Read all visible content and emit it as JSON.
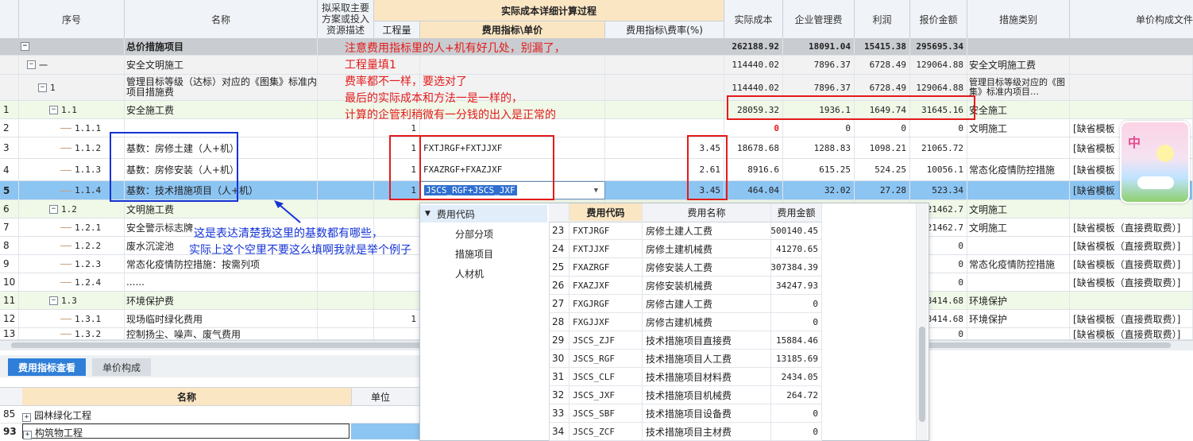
{
  "header": {
    "col_seq": "序号",
    "col_name": "名称",
    "col_resource": "拟采取主要方案或投入资源描述",
    "group_title": "实际成本详细计算过程",
    "col_qty": "工程量",
    "col_fee_index": "费用指标\\单价",
    "col_fee_rate": "费用指标\\费率(%)",
    "col_actual": "实际成本",
    "col_mgmt": "企业管理费",
    "col_profit": "利润",
    "col_quote": "报价金额",
    "col_category": "措施类别",
    "col_unit_comp": "单价构成文件"
  },
  "summary": {
    "name": "总价措施项目",
    "actual": "262188.92",
    "mgmt": "18091.04",
    "profit": "15415.38",
    "quote": "295695.34"
  },
  "rows": [
    {
      "seq": "",
      "code": "一",
      "name": "安全文明施工",
      "actual": "114440.02",
      "mgmt": "7896.37",
      "profit": "6728.49",
      "quote": "129064.88",
      "category": "安全文明施工费"
    },
    {
      "seq": "",
      "code": "1",
      "name": "管理目标等级（达标）对应的《图集》标准内项目措施费",
      "actual": "114440.02",
      "mgmt": "7896.37",
      "profit": "6728.49",
      "quote": "129064.88",
      "category": "管理目标等级对应的《图集》标准内项目…"
    },
    {
      "seq": "1",
      "code": "1.1",
      "name": "安全施工费",
      "actual": "28059.32",
      "mgmt": "1936.1",
      "profit": "1649.74",
      "quote": "31645.16",
      "category": "安全施工"
    },
    {
      "seq": "2",
      "code": "1.1.1",
      "name": "",
      "qty": "1",
      "actual": "0",
      "mgmt": "0",
      "profit": "0",
      "quote": "0",
      "category": "文明施工",
      "unit": "[缺省模板（"
    },
    {
      "seq": "3",
      "code": "1.1.2",
      "name": "基数：房修土建（人+机）",
      "qty": "1",
      "fee": "FXTJRGF+FXTJJXF",
      "rate": "3.45",
      "actual": "18678.68",
      "mgmt": "1288.83",
      "profit": "1098.21",
      "quote": "21065.72",
      "category": "",
      "unit": "[缺省模板（"
    },
    {
      "seq": "4",
      "code": "1.1.3",
      "name": "基数：房修安装（人+机）",
      "qty": "1",
      "fee": "FXAZRGF+FXAZJXF",
      "rate": "2.61",
      "actual": "8916.6",
      "mgmt": "615.25",
      "profit": "524.25",
      "quote": "10056.1",
      "category": "常态化疫情防控措施",
      "unit": "[缺省模板（"
    },
    {
      "seq": "5",
      "code": "1.1.4",
      "name": "基数：技术措施项目（人+机）",
      "qty": "1",
      "fee": "JSCS_RGF+JSCS_JXF",
      "rate": "3.45",
      "actual": "464.04",
      "mgmt": "32.02",
      "profit": "27.28",
      "quote": "523.34",
      "category": "",
      "unit": "[缺省模板（"
    },
    {
      "seq": "6",
      "code": "1.2",
      "name": "文明施工费",
      "quote": "21462.7",
      "category": "文明施工"
    },
    {
      "seq": "7",
      "code": "1.2.1",
      "name": "安全警示标志牌",
      "quote": "21462.7",
      "category": "文明施工",
      "unit": "[缺省模板（直接费取费）]"
    },
    {
      "seq": "8",
      "code": "1.2.2",
      "name": "废水沉淀池",
      "quote": "0",
      "category": "",
      "unit": "[缺省模板（直接费取费）]"
    },
    {
      "seq": "9",
      "code": "1.2.3",
      "name": "常态化疫情防控措施：按需列项",
      "quote": "0",
      "category": "常态化疫情防控措施",
      "unit": "[缺省模板（直接费取费）]"
    },
    {
      "seq": "10",
      "code": "1.2.4",
      "name": "......",
      "quote": "0",
      "category": "",
      "unit": "[缺省模板（直接费取费）]"
    },
    {
      "seq": "11",
      "code": "1.3",
      "name": "环境保护费",
      "quote": "28414.68",
      "category": "环境保护"
    },
    {
      "seq": "12",
      "code": "1.3.1",
      "name": "现场临时绿化费用",
      "qty": "1",
      "quote": "28414.68",
      "category": "环境保护",
      "unit": "[缺省模板（直接费取费）]"
    },
    {
      "seq": "13",
      "code": "1.3.2",
      "name": "控制扬尘、噪声、废气费用",
      "quote": "0",
      "category": "",
      "unit": "[缺省模板（直接费取费）]"
    }
  ],
  "notes": {
    "red_lines": [
      "注意费用指标里的人+机有好几处，别漏了，",
      "工程量填1",
      "费率都不一样，要选对了",
      "最后的实际成本和方法一是一样的，",
      "计算的企管利稍微有一分钱的出入是正常的"
    ],
    "blue_lines": [
      "这是表达清楚我这里的基数都有哪些，",
      "实际上这个空里不要这么填啊我就是举个例子"
    ]
  },
  "popup": {
    "tree_root": "费用代码",
    "tree_items": [
      "分部分项",
      "措施项目",
      "人材机"
    ],
    "col_code": "费用代码",
    "col_name": "费用名称",
    "col_amount": "费用金额",
    "rows": [
      {
        "n": "23",
        "code": "FXTJRGF",
        "name": "房修土建人工费",
        "amount": "500140.45"
      },
      {
        "n": "24",
        "code": "FXTJJXF",
        "name": "房修土建机械费",
        "amount": "41270.65"
      },
      {
        "n": "25",
        "code": "FXAZRGF",
        "name": "房修安装人工费",
        "amount": "307384.39"
      },
      {
        "n": "26",
        "code": "FXAZJXF",
        "name": "房修安装机械费",
        "amount": "34247.93"
      },
      {
        "n": "27",
        "code": "FXGJRGF",
        "name": "房修古建人工费",
        "amount": "0"
      },
      {
        "n": "28",
        "code": "FXGJJXF",
        "name": "房修古建机械费",
        "amount": "0"
      },
      {
        "n": "29",
        "code": "JSCS_ZJF",
        "name": "技术措施项目直接费",
        "amount": "15884.46"
      },
      {
        "n": "30",
        "code": "JSCS_RGF",
        "name": "技术措施项目人工费",
        "amount": "13185.69"
      },
      {
        "n": "31",
        "code": "JSCS_CLF",
        "name": "技术措施项目材料费",
        "amount": "2434.05"
      },
      {
        "n": "32",
        "code": "JSCS_JXF",
        "name": "技术措施项目机械费",
        "amount": "264.72"
      },
      {
        "n": "33",
        "code": "JSCS_SBF",
        "name": "技术措施项目设备费",
        "amount": "0"
      },
      {
        "n": "34",
        "code": "JSCS_ZCF",
        "name": "技术措施项目主材费",
        "amount": "0"
      }
    ]
  },
  "bottom": {
    "tab1": "费用指标查看",
    "tab2": "单价构成",
    "col_name": "名称",
    "col_unit": "单位",
    "rows": [
      {
        "n": "85",
        "name": "园林绿化工程"
      },
      {
        "n": "93",
        "name": "构筑物工程"
      }
    ]
  },
  "colors": {
    "accent": "#2f7fd8",
    "selected_row": "#8cc4f2",
    "red": "#e31b1b",
    "blue": "#1433d6"
  },
  "sticker_text": "中"
}
